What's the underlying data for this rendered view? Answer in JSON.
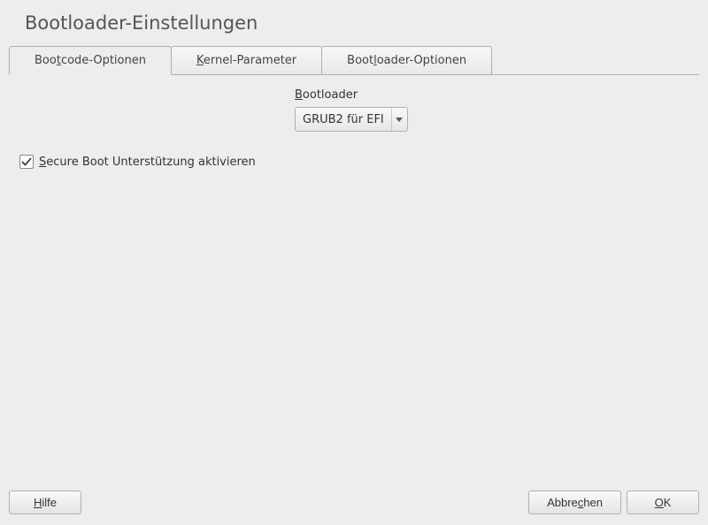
{
  "title": "Bootloader-Einstellungen",
  "tabs": [
    {
      "label_pre": "Boo",
      "label_u": "t",
      "label_post": "code-Optionen"
    },
    {
      "label_pre": "",
      "label_u": "K",
      "label_post": "ernel-Parameter"
    },
    {
      "label_pre": "Boot",
      "label_u": "l",
      "label_post": "oader-Optionen"
    }
  ],
  "bootloader": {
    "label_pre": "",
    "label_u": "B",
    "label_post": "ootloader",
    "value": "GRUB2 für EFI"
  },
  "secure_boot": {
    "checked": true,
    "label_pre": "",
    "label_u": "S",
    "label_post": "ecure Boot Unterstützung aktivieren"
  },
  "buttons": {
    "help": {
      "pre": "",
      "u": "H",
      "post": "ilfe"
    },
    "cancel": {
      "pre": "Abbre",
      "u": "c",
      "post": "hen"
    },
    "ok": {
      "pre": "",
      "u": "O",
      "post": "K"
    }
  }
}
